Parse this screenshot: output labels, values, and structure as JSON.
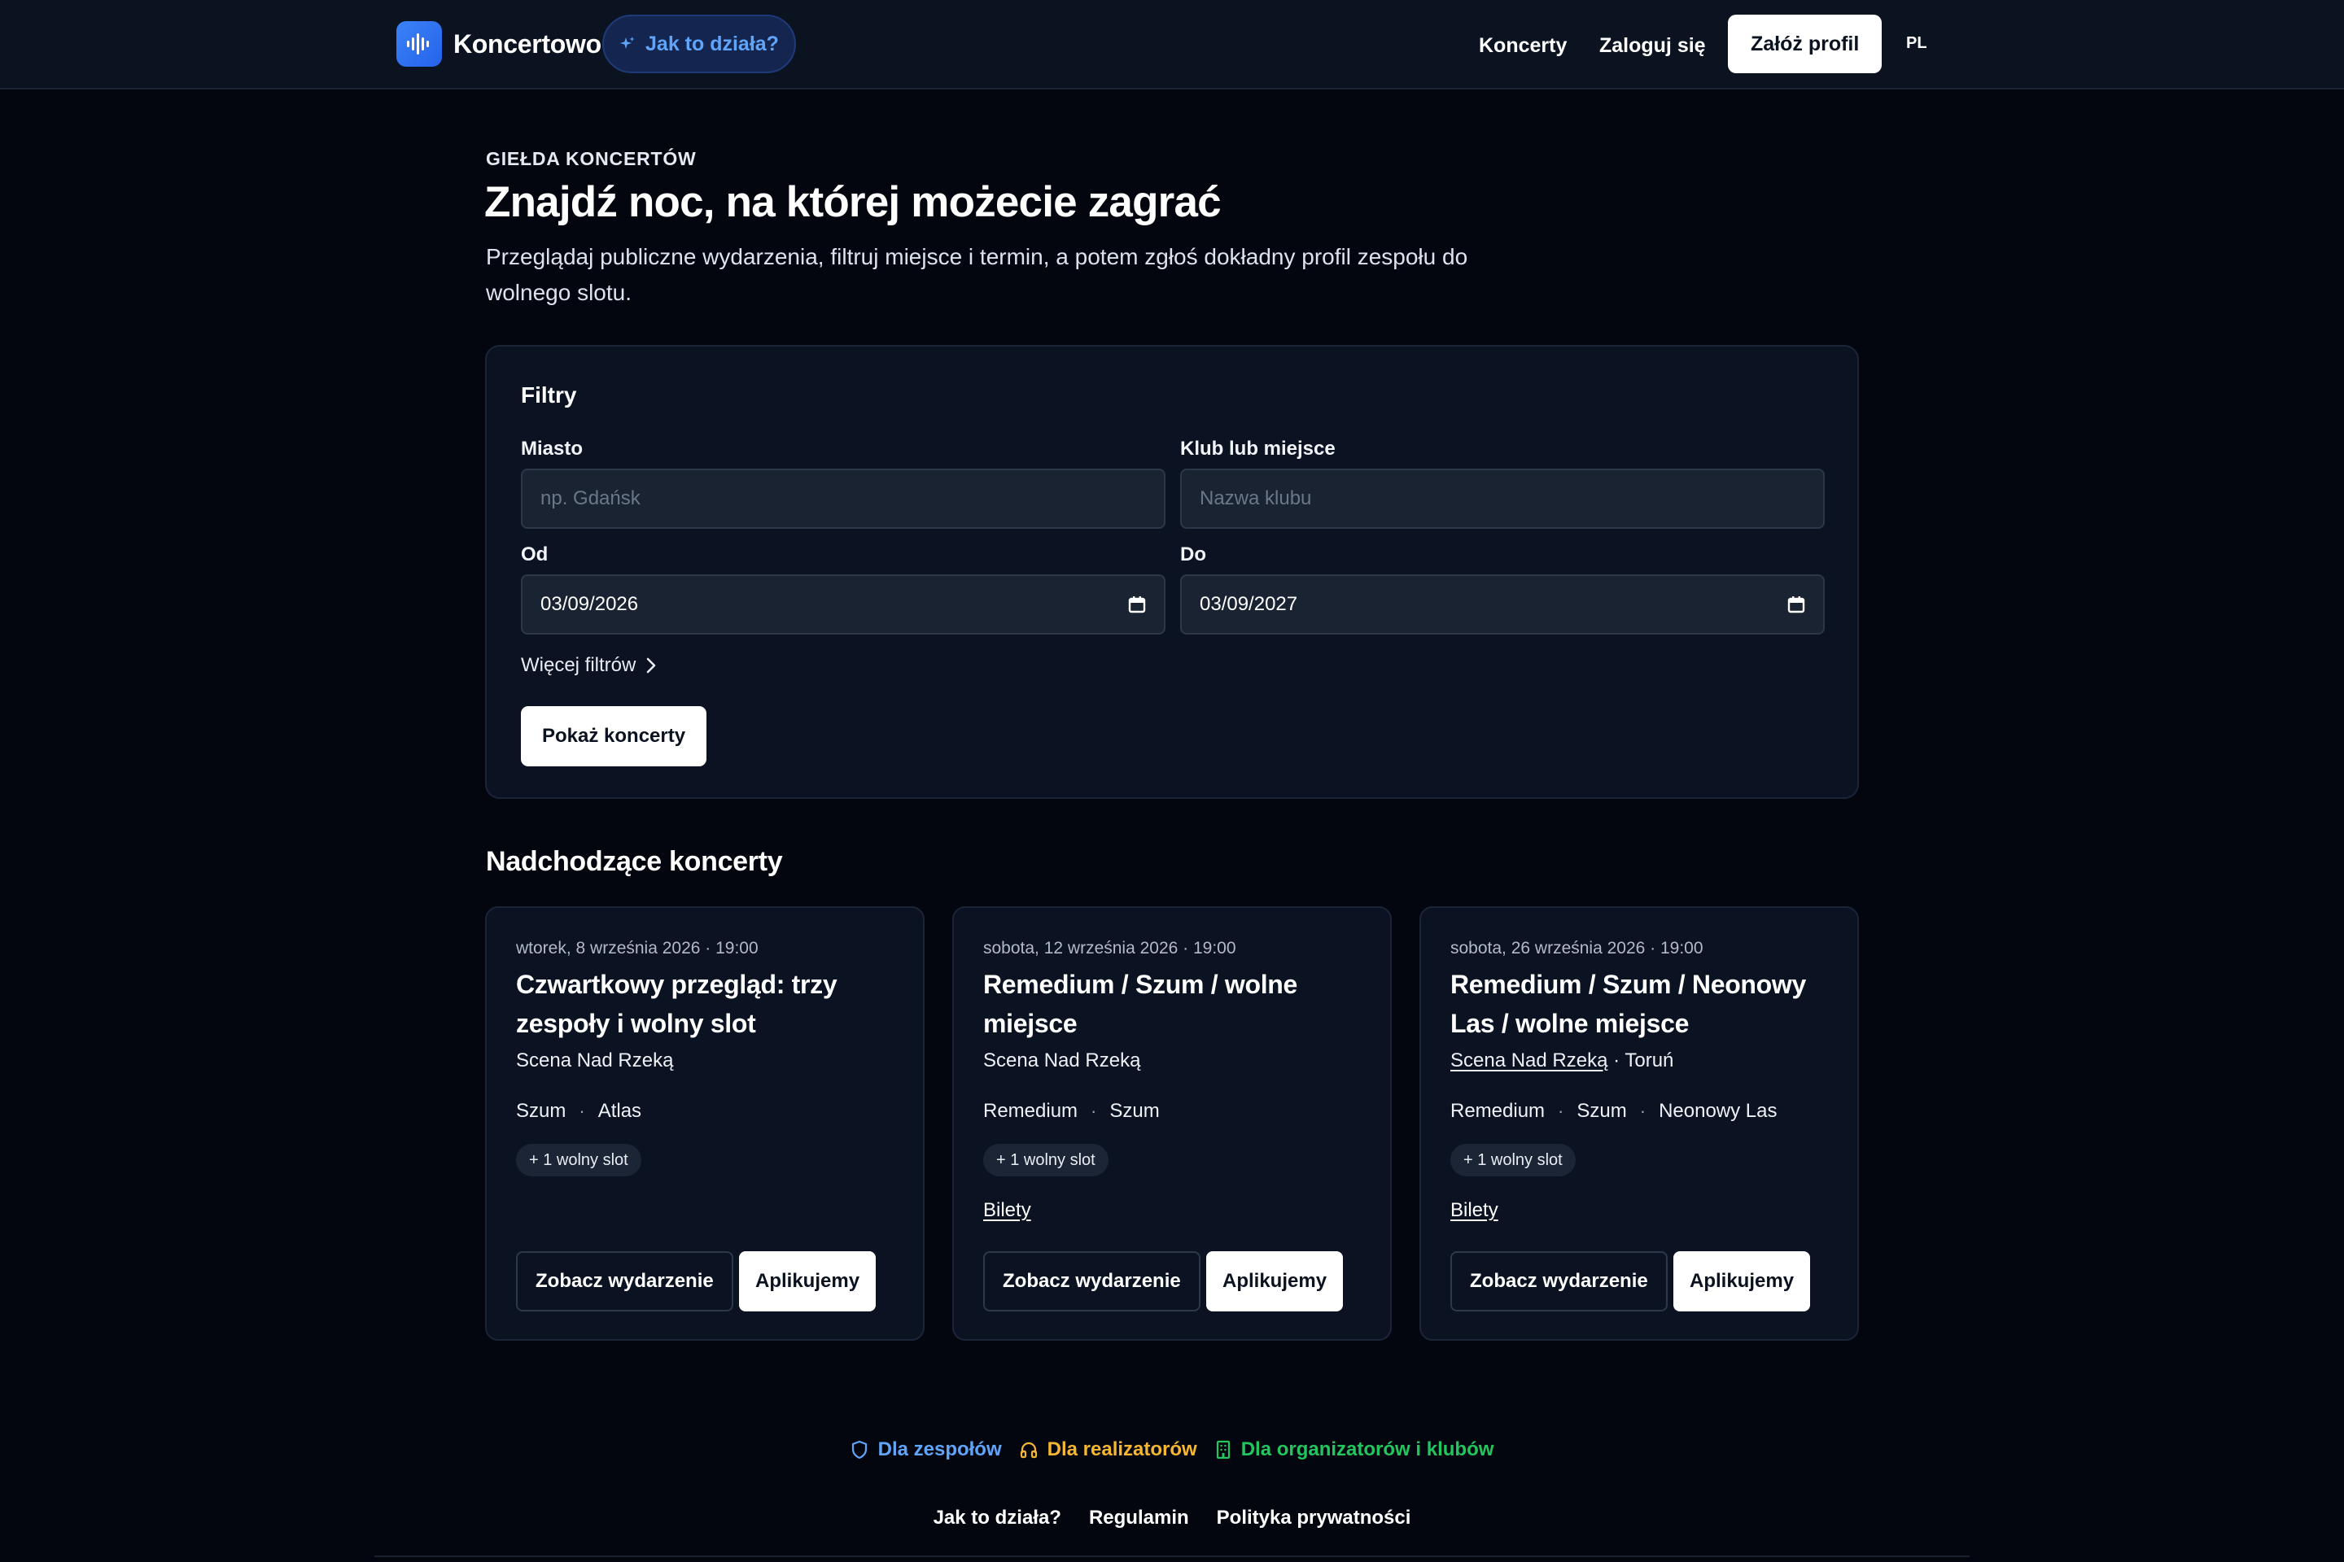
{
  "header": {
    "brand": "Koncertowo",
    "how_it_works": "Jak to działa?",
    "nav": {
      "concerts": "Koncerty",
      "login": "Zaloguj się",
      "signup": "Załóż profil",
      "lang": "PL"
    }
  },
  "hero": {
    "kicker": "GIEŁDA KONCERTÓW",
    "title": "Znajdź noc, na której możecie zagrać",
    "lead": "Przeglądaj publiczne wydarzenia, filtruj miejsce i termin, a potem zgłoś dokładny profil zespołu do wolnego slotu."
  },
  "filters": {
    "title": "Filtry",
    "city": {
      "label": "Miasto",
      "placeholder": "np. Gdańsk"
    },
    "club": {
      "label": "Klub lub miejsce",
      "placeholder": "Nazwa klubu"
    },
    "from": {
      "label": "Od",
      "value": "03/09/2026"
    },
    "to": {
      "label": "Do",
      "value": "03/09/2027"
    },
    "more": "Więcej filtrów",
    "submit": "Pokaż koncerty"
  },
  "upcoming": {
    "title": "Nadchodzące koncerty",
    "view_label": "Zobacz wydarzenie",
    "apply_label": "Aplikujemy",
    "cards": [
      {
        "date": "wtorek, 8 września 2026 · 19:00",
        "title": "Czwartkowy przegląd: trzy zespoły i wolny slot",
        "venue": "Scena Nad Rzeką",
        "bands": [
          "Szum",
          "Atlas"
        ],
        "slot": "+ 1 wolny slot"
      },
      {
        "date": "sobota, 12 września 2026 · 19:00",
        "title": "Remedium / Szum / wolne miejsce",
        "venue": "Scena Nad Rzeką",
        "bands": [
          "Remedium",
          "Szum"
        ],
        "slot": "+ 1 wolny slot",
        "tickets": "Bilety"
      },
      {
        "date": "sobota, 26 września 2026 · 19:00",
        "title": "Remedium / Szum / Neonowy Las / wolne miejsce",
        "venue": "Scena Nad Rzeką",
        "city": "· Toruń",
        "bands": [
          "Remedium",
          "Szum",
          "Neonowy Las"
        ],
        "slot": "+ 1 wolny slot",
        "tickets": "Bilety"
      }
    ]
  },
  "footer": {
    "for_bands": "Dla zespołów",
    "for_engineers": "Dla realizatorów",
    "for_organizers": "Dla organizatorów i klubów",
    "links": [
      "Jak to działa?",
      "Regulamin",
      "Polityka prywatności"
    ]
  },
  "colors": {
    "background": "#03060f",
    "panel": "#0b1322",
    "accent_blue": "#60a5fa",
    "accent_yellow": "#f5b731",
    "accent_green": "#22c55e"
  }
}
